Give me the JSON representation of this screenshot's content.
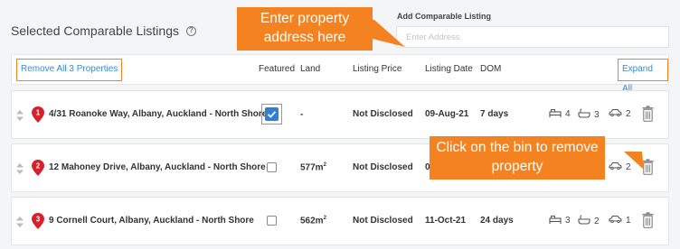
{
  "title": "Selected Comparable Listings",
  "add_listing": {
    "label": "Add Comparable Listing",
    "placeholder": "Enter Address"
  },
  "callouts": {
    "enter_address": "Enter property address here",
    "bin": "Click on the bin to remove property"
  },
  "header": {
    "remove_all": "Remove All 3 Properties",
    "featured": "Featured",
    "land": "Land",
    "listing_price": "Listing Price",
    "listing_date": "Listing Date",
    "dom": "DOM",
    "expand_all": "Expand All"
  },
  "listings": [
    {
      "num": "1",
      "address": "4/31 Roanoke Way, Albany, Auckland - North Shore",
      "featured": true,
      "land": "-",
      "land_unit": "",
      "land_sup": "",
      "price": "Not Disclosed",
      "date": "09-Aug-21",
      "dom": "7 days",
      "beds": "4",
      "baths": "3",
      "cars": "2"
    },
    {
      "num": "2",
      "address": "12 Mahoney Drive, Albany, Auckland - North Shore",
      "featured": false,
      "land": "577m",
      "land_sup": "2",
      "price": "Not Disclosed",
      "date": "05",
      "dom": "",
      "beds": "",
      "baths": "",
      "cars": "2"
    },
    {
      "num": "3",
      "address": "9 Cornell Court, Albany, Auckland - North Shore",
      "featured": false,
      "land": "562m",
      "land_sup": "2",
      "price": "Not Disclosed",
      "date": "11-Oct-21",
      "dom": "24 days",
      "beds": "3",
      "baths": "2",
      "cars": "1"
    }
  ],
  "colors": {
    "accent": "#f58220",
    "link": "#3a8ad0",
    "checkbox": "#2f7fd2",
    "pin": "#d9202a"
  }
}
